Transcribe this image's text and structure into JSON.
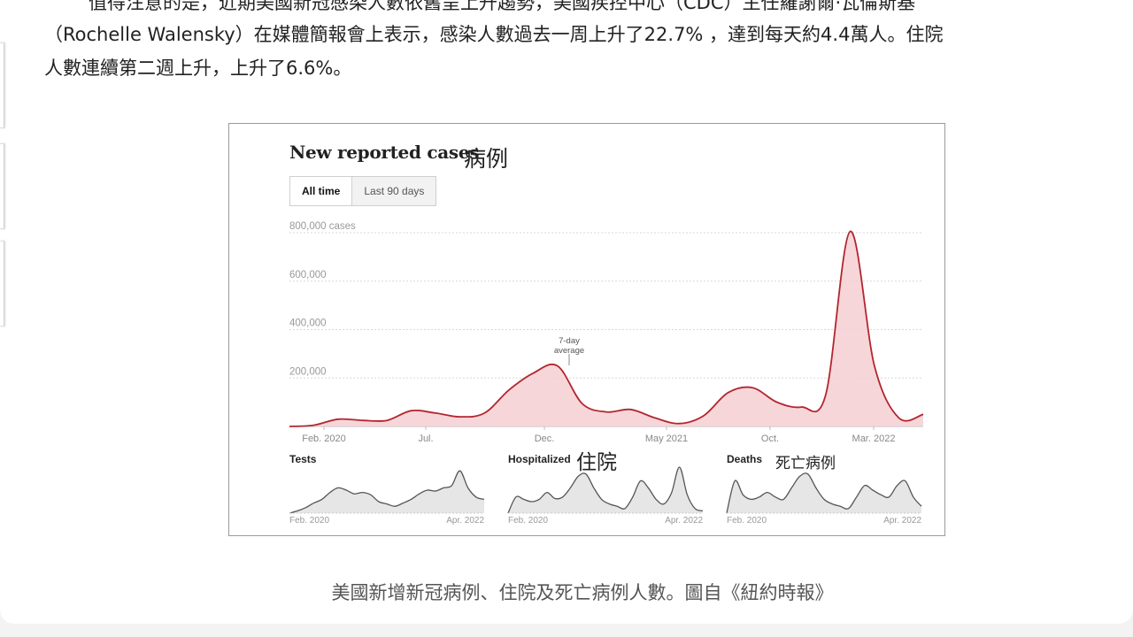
{
  "article": {
    "line1": "值得注意的是，近期美國新冠感染人數依舊呈上升趨勢，美國疾控中心（CDC）主任羅謝爾·瓦倫斯基",
    "line2": "（Rochelle Walensky）在媒體簡報會上表示，感染人數過去一周上升了22.7% ，達到每天約4.4萬人。住院",
    "line3": "人數連續第二週上升，上升了6.6%。"
  },
  "figure": {
    "title": "New reported cases",
    "title_cjk": "病例",
    "tabs": [
      {
        "label": "All time",
        "active": true
      },
      {
        "label": "Last 90 days",
        "active": false
      }
    ],
    "annotation": "7-day average",
    "caption": "美國新增新冠病例、住院及死亡病例人數。圖自《紐約時報》",
    "colors": {
      "cases_line": "#b3262e",
      "cases_fill": "#f6cfd3",
      "small_line": "#555555",
      "small_fill": "#e6e6e6"
    }
  },
  "chart_data": [
    {
      "type": "area",
      "title": "New reported cases",
      "ylabel": "",
      "y_ticks": [
        "800,000 cases",
        "600,000",
        "400,000",
        "200,000"
      ],
      "x_ticks": [
        "Feb. 2020",
        "Jul.",
        "Dec.",
        "May 2021",
        "Oct.",
        "Mar. 2022"
      ],
      "ylim": [
        0,
        800000
      ],
      "grid": true,
      "series": [
        {
          "name": "7-day average",
          "x": [
            "2020-02",
            "2020-03",
            "2020-04",
            "2020-05",
            "2020-06",
            "2020-07",
            "2020-08",
            "2020-09",
            "2020-10",
            "2020-11",
            "2020-12",
            "2021-01",
            "2021-02",
            "2021-03",
            "2021-04",
            "2021-05",
            "2021-06",
            "2021-07",
            "2021-08",
            "2021-09",
            "2021-10",
            "2021-11",
            "2021-12",
            "2022-01",
            "2022-02",
            "2022-03",
            "2022-04"
          ],
          "values": [
            0,
            5000,
            30000,
            25000,
            25000,
            65000,
            55000,
            40000,
            55000,
            150000,
            220000,
            250000,
            95000,
            60000,
            70000,
            35000,
            12000,
            45000,
            140000,
            160000,
            100000,
            80000,
            130000,
            805000,
            250000,
            35000,
            50000
          ]
        }
      ]
    },
    {
      "type": "area",
      "title": "Tests",
      "x_ticks": [
        "Feb. 2020",
        "Apr. 2022"
      ],
      "series": [
        {
          "name": "",
          "values": [
            0.0,
            0.05,
            0.12,
            0.22,
            0.3,
            0.45,
            0.55,
            0.5,
            0.42,
            0.45,
            0.4,
            0.25,
            0.2,
            0.15,
            0.22,
            0.3,
            0.42,
            0.5,
            0.48,
            0.55,
            0.6,
            0.92,
            0.55,
            0.35,
            0.3
          ]
        }
      ]
    },
    {
      "type": "area",
      "title": "Hospitalized",
      "title_cjk": "住院",
      "x_ticks": [
        "Feb. 2020",
        "Apr. 2022"
      ],
      "series": [
        {
          "name": "",
          "values": [
            0.0,
            0.35,
            0.3,
            0.25,
            0.3,
            0.45,
            0.32,
            0.35,
            0.55,
            0.8,
            0.85,
            0.55,
            0.3,
            0.2,
            0.15,
            0.1,
            0.35,
            0.7,
            0.55,
            0.3,
            0.2,
            0.45,
            1.0,
            0.4,
            0.1,
            0.05
          ]
        }
      ]
    },
    {
      "type": "area",
      "title": "Deaths",
      "title_cjk": "死亡病例",
      "x_ticks": [
        "Feb. 2020",
        "Apr. 2022"
      ],
      "series": [
        {
          "name": "",
          "values": [
            0.0,
            0.7,
            0.4,
            0.3,
            0.35,
            0.45,
            0.35,
            0.3,
            0.55,
            0.8,
            0.85,
            0.55,
            0.3,
            0.2,
            0.15,
            0.1,
            0.35,
            0.6,
            0.5,
            0.4,
            0.35,
            0.6,
            0.7,
            0.35,
            0.15
          ]
        }
      ]
    }
  ]
}
